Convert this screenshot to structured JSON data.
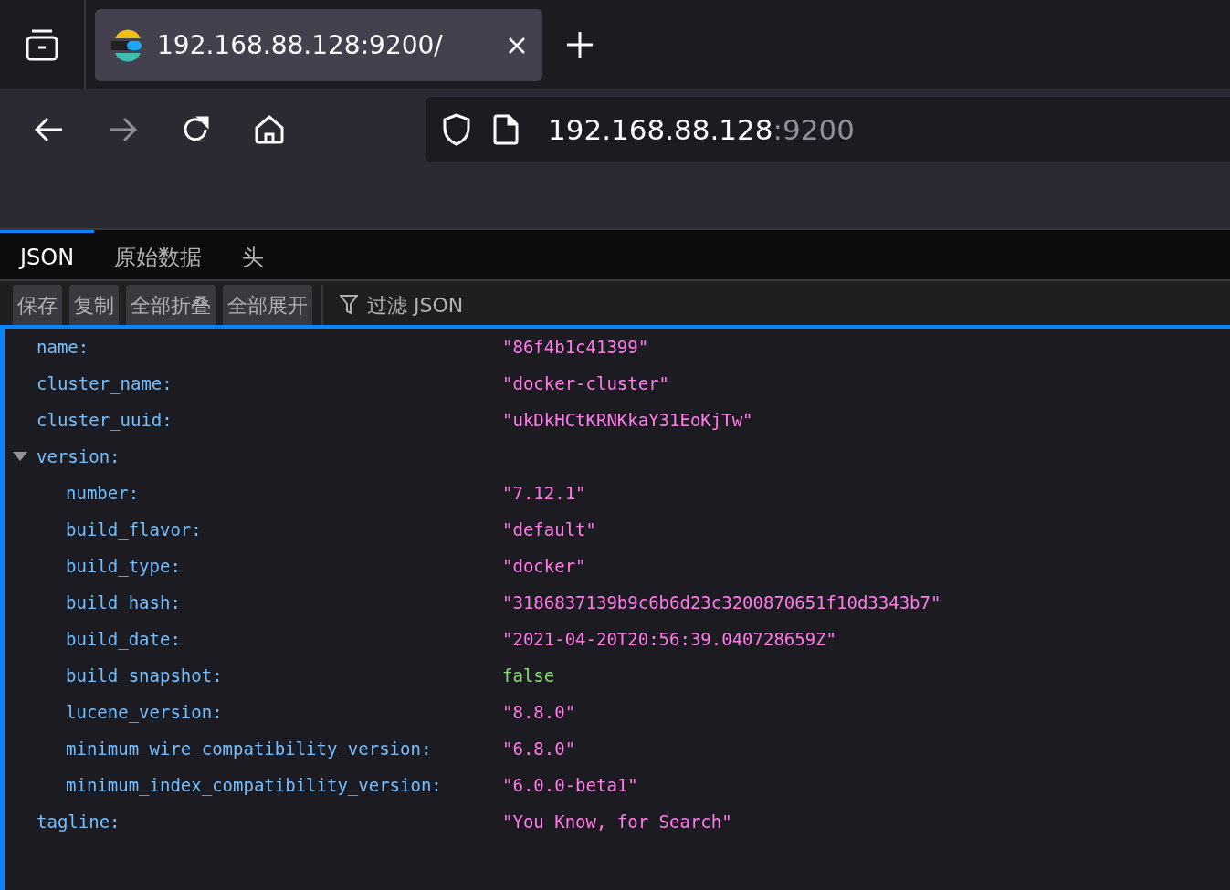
{
  "browser_tab": {
    "title": "192.168.88.128:9200/"
  },
  "address": {
    "host": "192.168.88.128",
    "port": ":9200"
  },
  "viewer_tabs": [
    {
      "label": "JSON",
      "selected": true
    },
    {
      "label": "原始数据",
      "selected": false
    },
    {
      "label": "头",
      "selected": false
    }
  ],
  "toolbar_buttons": [
    "保存",
    "复制",
    "全部折叠",
    "全部展开"
  ],
  "filter": {
    "placeholder": "过滤 JSON"
  },
  "rows": [
    {
      "key": "name:",
      "value": "\"86f4b1c41399\"",
      "kind": "string"
    },
    {
      "key": "cluster_name:",
      "value": "\"docker-cluster\"",
      "kind": "string"
    },
    {
      "key": "cluster_uuid:",
      "value": "\"ukDkHCtKRNKkaY31EoKjTw\"",
      "kind": "string"
    },
    {
      "key": "version:",
      "kind": "object",
      "expanded": true,
      "children": [
        {
          "key": "number:",
          "value": "\"7.12.1\"",
          "kind": "string"
        },
        {
          "key": "build_flavor:",
          "value": "\"default\"",
          "kind": "string"
        },
        {
          "key": "build_type:",
          "value": "\"docker\"",
          "kind": "string"
        },
        {
          "key": "build_hash:",
          "value": "\"3186837139b9c6b6d23c3200870651f10d3343b7\"",
          "kind": "string"
        },
        {
          "key": "build_date:",
          "value": "\"2021-04-20T20:56:39.040728659Z\"",
          "kind": "string"
        },
        {
          "key": "build_snapshot:",
          "value": "false",
          "kind": "boolean"
        },
        {
          "key": "lucene_version:",
          "value": "\"8.8.0\"",
          "kind": "string"
        },
        {
          "key": "minimum_wire_compatibility_version:",
          "value": "\"6.8.0\"",
          "kind": "string"
        },
        {
          "key": "minimum_index_compatibility_version:",
          "value": "\"6.0.0-beta1\"",
          "kind": "string"
        }
      ]
    },
    {
      "key": "tagline:",
      "value": "\"You Know, for Search\"",
      "kind": "string"
    }
  ]
}
